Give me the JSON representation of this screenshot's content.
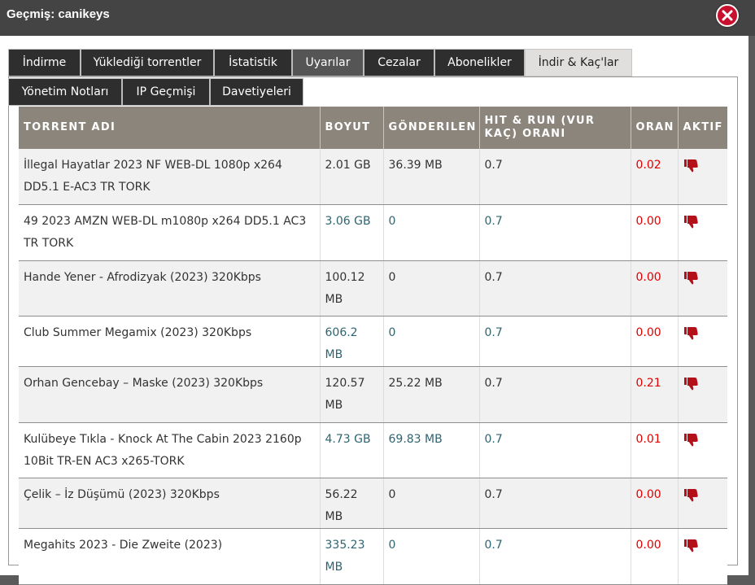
{
  "window": {
    "title": "Geçmiş: canikeys"
  },
  "tabs": [
    {
      "label": "İndirme"
    },
    {
      "label": "Yüklediği torrentler"
    },
    {
      "label": "İstatistik"
    },
    {
      "label": "Uyarılar"
    },
    {
      "label": "Cezalar"
    },
    {
      "label": "Abonelikler"
    },
    {
      "label": "İndir & Kaç'lar"
    },
    {
      "label": "Yönetim Notları"
    },
    {
      "label": "IP Geçmişi"
    },
    {
      "label": "Davetiyeleri"
    }
  ],
  "table": {
    "headers": [
      "Torrent Adı",
      "Boyut",
      "Gönderilen",
      "Hit & Run (Vur Kaç) Oranı",
      "Oran",
      "Aktif"
    ],
    "rows": [
      {
        "name": "İllegal Hayatlar 2023 NF WEB-DL 1080p x264 DD5.1 E-AC3 TR TORK",
        "size": "2.01 GB",
        "sent": "36.39 MB",
        "hr": "0.7",
        "ratio": "0.02"
      },
      {
        "name": "49 2023 AMZN WEB-DL m1080p x264 DD5.1 AC3 TR TORK",
        "size": "3.06 GB",
        "sent": "0",
        "hr": "0.7",
        "ratio": "0.00"
      },
      {
        "name": "Hande Yener - Afrodizyak (2023) 320Kbps",
        "size": "100.12 MB",
        "sent": "0",
        "hr": "0.7",
        "ratio": "0.00"
      },
      {
        "name": "Club Summer Megamix (2023) 320Kbps",
        "size": "606.2 MB",
        "sent": "0",
        "hr": "0.7",
        "ratio": "0.00"
      },
      {
        "name": "Orhan Gencebay – Maske (2023) 320Kbps",
        "size": "120.57 MB",
        "sent": "25.22 MB",
        "hr": "0.7",
        "ratio": "0.21"
      },
      {
        "name": "Kulübeye Tıkla - Knock At The Cabin 2023 2160p 10Bit TR-EN AC3 x265-TORK",
        "size": "4.73 GB",
        "sent": "69.83 MB",
        "hr": "0.7",
        "ratio": "0.01"
      },
      {
        "name": "Çelik – İz Düşümü (2023) 320Kbps",
        "size": "56.22 MB",
        "sent": "0",
        "hr": "0.7",
        "ratio": "0.00"
      },
      {
        "name": "Megahits 2023 - Die Zweite (2023)",
        "size": "335.23 MB",
        "sent": "0",
        "hr": "0.7",
        "ratio": "0.00"
      }
    ],
    "active_icon": "thumbs-down-icon"
  },
  "colors": {
    "header_bg": "#8b857c",
    "tab_bg": "#2e2e2e",
    "active_tab_bg": "#e1dede",
    "ratio_red": "#e00000",
    "close_red": "#c8102e"
  }
}
